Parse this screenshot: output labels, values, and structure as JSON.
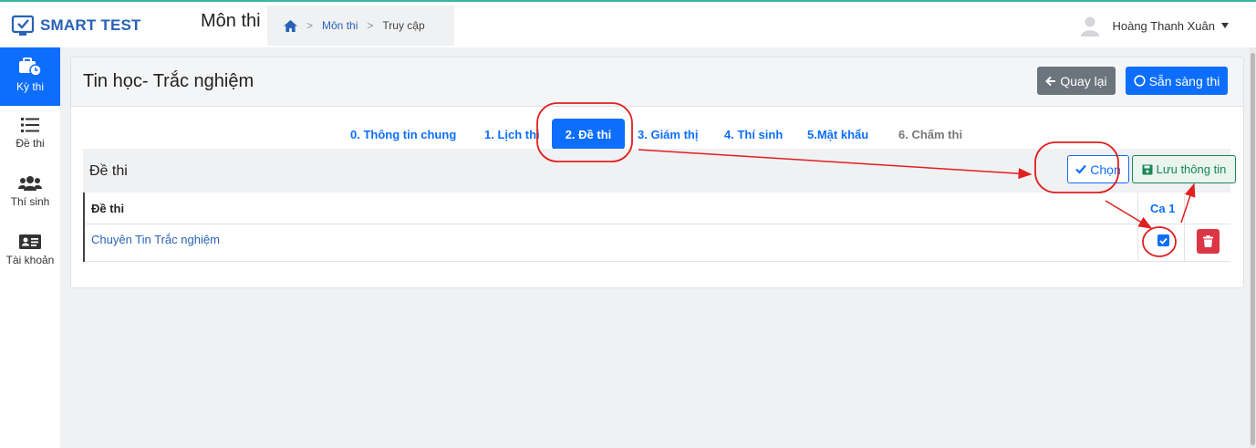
{
  "app": {
    "logo_text": "SMART TEST"
  },
  "header": {
    "page_heading": "Môn thi",
    "breadcrumb": {
      "link": "Môn thi",
      "current": "Truy cập"
    },
    "user_name": "Hoàng Thanh Xuân"
  },
  "sidebar": {
    "items": [
      {
        "label": "Kỳ thi",
        "icon": "briefcase-clock-icon",
        "active": true
      },
      {
        "label": "Đề thi",
        "icon": "list-icon",
        "active": false
      },
      {
        "label": "Thí sinh",
        "icon": "users-icon",
        "active": false
      },
      {
        "label": "Tài khoản",
        "icon": "id-card-icon",
        "active": false
      }
    ]
  },
  "card": {
    "title": "Tin học- Trắc nghiệm",
    "back_label": "Quay lại",
    "ready_label": "Sẵn sàng thi"
  },
  "tabs": [
    {
      "label": "0. Thông tin chung"
    },
    {
      "label": "1. Lịch thi"
    },
    {
      "label": "2. Đề thi",
      "active": true
    },
    {
      "label": "3. Giám thị"
    },
    {
      "label": "4. Thí sinh"
    },
    {
      "label": "5.Mật khẩu"
    },
    {
      "label": "6. Chấm thi",
      "disabled": true
    }
  ],
  "panel": {
    "title": "Đề thi",
    "choose_label": "Chọn",
    "save_label": "Lưu thông tin"
  },
  "table": {
    "col_exam": "Đề thi",
    "col_shift": "Ca 1",
    "rows": [
      {
        "exam": "Chuyên Tin Trắc nghiệm",
        "checked": true
      }
    ]
  },
  "colors": {
    "primary": "#0d6efd",
    "danger": "#dc3545",
    "success": "#198754",
    "annotation": "#e02020"
  }
}
